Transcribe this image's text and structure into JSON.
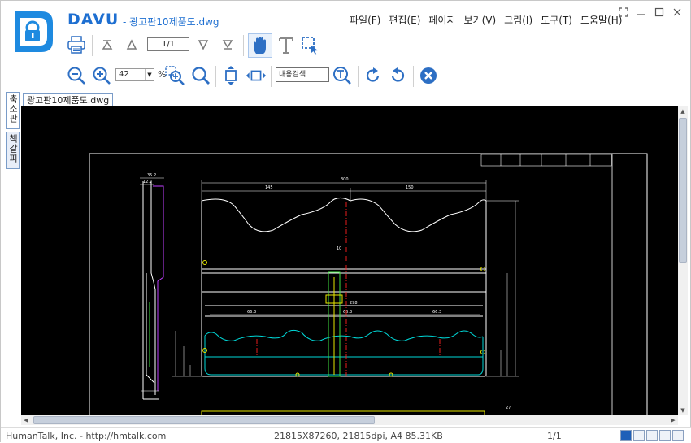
{
  "app": {
    "brand": "DAVU",
    "doc_title": "- 광고판10제품도.dwg"
  },
  "menu": [
    "파일(F)",
    "편집(E)",
    "페이지",
    "보기(V)",
    "그림(I)",
    "도구(T)",
    "도움말(H)"
  ],
  "toolbar": {
    "page_value": "1/1",
    "zoom_value": "42",
    "zoom_unit": "%",
    "search_placeholder": "내용검색"
  },
  "side_tabs": [
    "축소판",
    "책갈피"
  ],
  "document_tab": "광고판10제품도.dwg",
  "drawing": {
    "dims": [
      "35.2",
      "12.7",
      "300",
      "145",
      "150",
      "66.3",
      "66.3",
      "66.3",
      "298",
      "10",
      "27"
    ]
  },
  "status": {
    "company": "HumanTalk, Inc. - http://hmtalk.com",
    "doc_info": "21815X87260, 21815dpi, A4  85.31KB",
    "page": "1/1"
  },
  "colors": {
    "accent": "#1e6fd1",
    "toolbar_icon": "#2d6fc4",
    "cad_background": "#000000",
    "cad_lines": "#ffffff",
    "cad_cyan": "#00d8d8",
    "cad_magenta": "#c040ff",
    "cad_red": "#ff2020",
    "cad_yellow": "#e8e800",
    "cad_green": "#40e040"
  }
}
